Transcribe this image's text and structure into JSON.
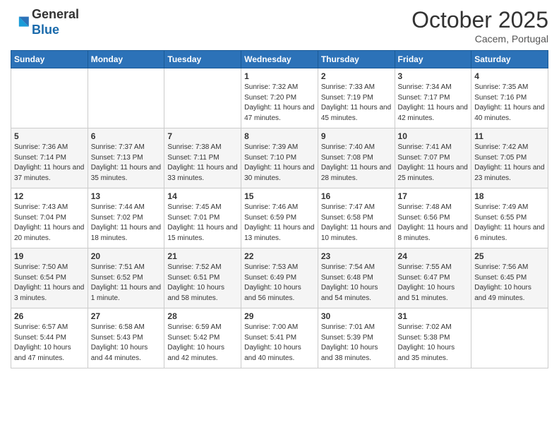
{
  "header": {
    "logo_general": "General",
    "logo_blue": "Blue",
    "month": "October 2025",
    "location": "Cacem, Portugal"
  },
  "weekdays": [
    "Sunday",
    "Monday",
    "Tuesday",
    "Wednesday",
    "Thursday",
    "Friday",
    "Saturday"
  ],
  "weeks": [
    [
      {
        "day": "",
        "info": ""
      },
      {
        "day": "",
        "info": ""
      },
      {
        "day": "",
        "info": ""
      },
      {
        "day": "1",
        "info": "Sunrise: 7:32 AM\nSunset: 7:20 PM\nDaylight: 11 hours and 47 minutes."
      },
      {
        "day": "2",
        "info": "Sunrise: 7:33 AM\nSunset: 7:19 PM\nDaylight: 11 hours and 45 minutes."
      },
      {
        "day": "3",
        "info": "Sunrise: 7:34 AM\nSunset: 7:17 PM\nDaylight: 11 hours and 42 minutes."
      },
      {
        "day": "4",
        "info": "Sunrise: 7:35 AM\nSunset: 7:16 PM\nDaylight: 11 hours and 40 minutes."
      }
    ],
    [
      {
        "day": "5",
        "info": "Sunrise: 7:36 AM\nSunset: 7:14 PM\nDaylight: 11 hours and 37 minutes."
      },
      {
        "day": "6",
        "info": "Sunrise: 7:37 AM\nSunset: 7:13 PM\nDaylight: 11 hours and 35 minutes."
      },
      {
        "day": "7",
        "info": "Sunrise: 7:38 AM\nSunset: 7:11 PM\nDaylight: 11 hours and 33 minutes."
      },
      {
        "day": "8",
        "info": "Sunrise: 7:39 AM\nSunset: 7:10 PM\nDaylight: 11 hours and 30 minutes."
      },
      {
        "day": "9",
        "info": "Sunrise: 7:40 AM\nSunset: 7:08 PM\nDaylight: 11 hours and 28 minutes."
      },
      {
        "day": "10",
        "info": "Sunrise: 7:41 AM\nSunset: 7:07 PM\nDaylight: 11 hours and 25 minutes."
      },
      {
        "day": "11",
        "info": "Sunrise: 7:42 AM\nSunset: 7:05 PM\nDaylight: 11 hours and 23 minutes."
      }
    ],
    [
      {
        "day": "12",
        "info": "Sunrise: 7:43 AM\nSunset: 7:04 PM\nDaylight: 11 hours and 20 minutes."
      },
      {
        "day": "13",
        "info": "Sunrise: 7:44 AM\nSunset: 7:02 PM\nDaylight: 11 hours and 18 minutes."
      },
      {
        "day": "14",
        "info": "Sunrise: 7:45 AM\nSunset: 7:01 PM\nDaylight: 11 hours and 15 minutes."
      },
      {
        "day": "15",
        "info": "Sunrise: 7:46 AM\nSunset: 6:59 PM\nDaylight: 11 hours and 13 minutes."
      },
      {
        "day": "16",
        "info": "Sunrise: 7:47 AM\nSunset: 6:58 PM\nDaylight: 11 hours and 10 minutes."
      },
      {
        "day": "17",
        "info": "Sunrise: 7:48 AM\nSunset: 6:56 PM\nDaylight: 11 hours and 8 minutes."
      },
      {
        "day": "18",
        "info": "Sunrise: 7:49 AM\nSunset: 6:55 PM\nDaylight: 11 hours and 6 minutes."
      }
    ],
    [
      {
        "day": "19",
        "info": "Sunrise: 7:50 AM\nSunset: 6:54 PM\nDaylight: 11 hours and 3 minutes."
      },
      {
        "day": "20",
        "info": "Sunrise: 7:51 AM\nSunset: 6:52 PM\nDaylight: 11 hours and 1 minute."
      },
      {
        "day": "21",
        "info": "Sunrise: 7:52 AM\nSunset: 6:51 PM\nDaylight: 10 hours and 58 minutes."
      },
      {
        "day": "22",
        "info": "Sunrise: 7:53 AM\nSunset: 6:49 PM\nDaylight: 10 hours and 56 minutes."
      },
      {
        "day": "23",
        "info": "Sunrise: 7:54 AM\nSunset: 6:48 PM\nDaylight: 10 hours and 54 minutes."
      },
      {
        "day": "24",
        "info": "Sunrise: 7:55 AM\nSunset: 6:47 PM\nDaylight: 10 hours and 51 minutes."
      },
      {
        "day": "25",
        "info": "Sunrise: 7:56 AM\nSunset: 6:45 PM\nDaylight: 10 hours and 49 minutes."
      }
    ],
    [
      {
        "day": "26",
        "info": "Sunrise: 6:57 AM\nSunset: 5:44 PM\nDaylight: 10 hours and 47 minutes."
      },
      {
        "day": "27",
        "info": "Sunrise: 6:58 AM\nSunset: 5:43 PM\nDaylight: 10 hours and 44 minutes."
      },
      {
        "day": "28",
        "info": "Sunrise: 6:59 AM\nSunset: 5:42 PM\nDaylight: 10 hours and 42 minutes."
      },
      {
        "day": "29",
        "info": "Sunrise: 7:00 AM\nSunset: 5:41 PM\nDaylight: 10 hours and 40 minutes."
      },
      {
        "day": "30",
        "info": "Sunrise: 7:01 AM\nSunset: 5:39 PM\nDaylight: 10 hours and 38 minutes."
      },
      {
        "day": "31",
        "info": "Sunrise: 7:02 AM\nSunset: 5:38 PM\nDaylight: 10 hours and 35 minutes."
      },
      {
        "day": "",
        "info": ""
      }
    ]
  ]
}
